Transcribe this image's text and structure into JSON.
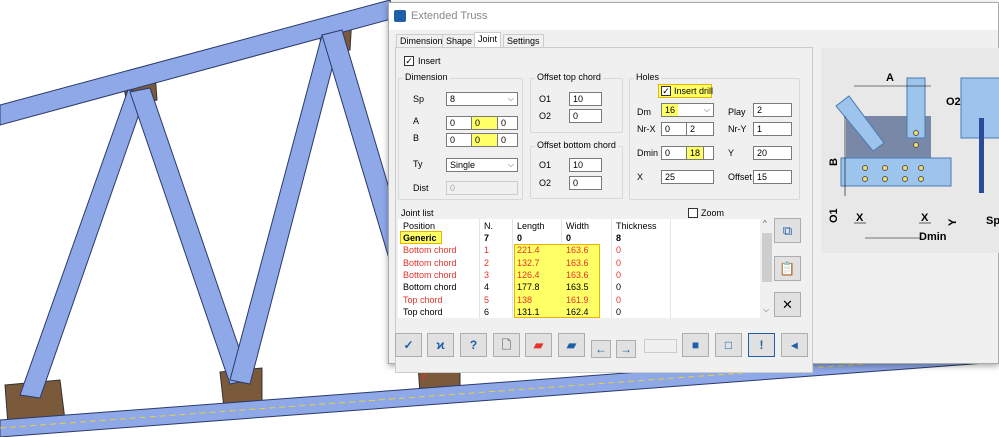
{
  "window": {
    "title": "Extended Truss"
  },
  "tabs": [
    "Dimension",
    "Shape",
    "Joint",
    "Settings"
  ],
  "insert": {
    "label": "Insert",
    "checked": true
  },
  "dimension": {
    "title": "Dimension",
    "sp_label": "Sp",
    "sp_value": "8",
    "a_label": "A",
    "a_values": [
      "0",
      "0",
      "0"
    ],
    "b_label": "B",
    "b_values": [
      "0",
      "0",
      "0"
    ],
    "ty_label": "Ty",
    "ty_value": "Single",
    "dist_label": "Dist",
    "dist_value": "0"
  },
  "offset_top": {
    "title": "Offset top chord",
    "o1_label": "O1",
    "o1": "10",
    "o2_label": "O2",
    "o2": "0"
  },
  "offset_bottom": {
    "title": "Offset bottom chord",
    "o1_label": "O1",
    "o1": "10",
    "o2_label": "O2",
    "o2": "0"
  },
  "holes": {
    "title": "Holes",
    "insert_drill": "Insert drill",
    "dm_label": "Dm",
    "dm": "16",
    "play_label": "Play",
    "play": "2",
    "nrx_label": "Nr-X",
    "nrx": [
      "0",
      "2"
    ],
    "nry_label": "Nr-Y",
    "nry": "1",
    "dmin_label": "Dmin",
    "dmin": [
      "0",
      "18"
    ],
    "y_label": "Y",
    "y": "20",
    "x_label": "X",
    "x": "25",
    "offset_label": "Offset",
    "offset": "15"
  },
  "joint_list": {
    "title": "Joint list",
    "zoom_label": "Zoom",
    "columns": [
      "Position",
      "N.",
      "Length",
      "Width",
      "Thickness"
    ],
    "rows": [
      {
        "position": "Generic",
        "n": "7",
        "length": "0",
        "width": "0",
        "thickness": "8",
        "style": "bold"
      },
      {
        "position": "Bottom chord",
        "n": "1",
        "length": "221.4",
        "width": "163.6",
        "thickness": "0",
        "style": "red"
      },
      {
        "position": "Bottom chord",
        "n": "2",
        "length": "132.7",
        "width": "163.6",
        "thickness": "0",
        "style": "red"
      },
      {
        "position": "Bottom chord",
        "n": "3",
        "length": "126.4",
        "width": "163.6",
        "thickness": "0",
        "style": "red"
      },
      {
        "position": "Bottom chord",
        "n": "4",
        "length": "177.8",
        "width": "163.5",
        "thickness": "0",
        "style": "normal"
      },
      {
        "position": "Top chord",
        "n": "5",
        "length": "138",
        "width": "161.9",
        "thickness": "0",
        "style": "red"
      },
      {
        "position": "Top chord",
        "n": "6",
        "length": "131.1",
        "width": "162.4",
        "thickness": "0",
        "style": "normal"
      }
    ]
  },
  "diagram": {
    "labels": [
      "A",
      "O2",
      "B",
      "O1",
      "X",
      "X",
      "Y",
      "Sp",
      "Dmin"
    ]
  },
  "colors": {
    "highlight": "#ffff66",
    "red_text": "#e8322c",
    "accent": "#1e5fa8",
    "truss_blue": "#8fa8e8",
    "gusset": "#7a5a3a"
  }
}
